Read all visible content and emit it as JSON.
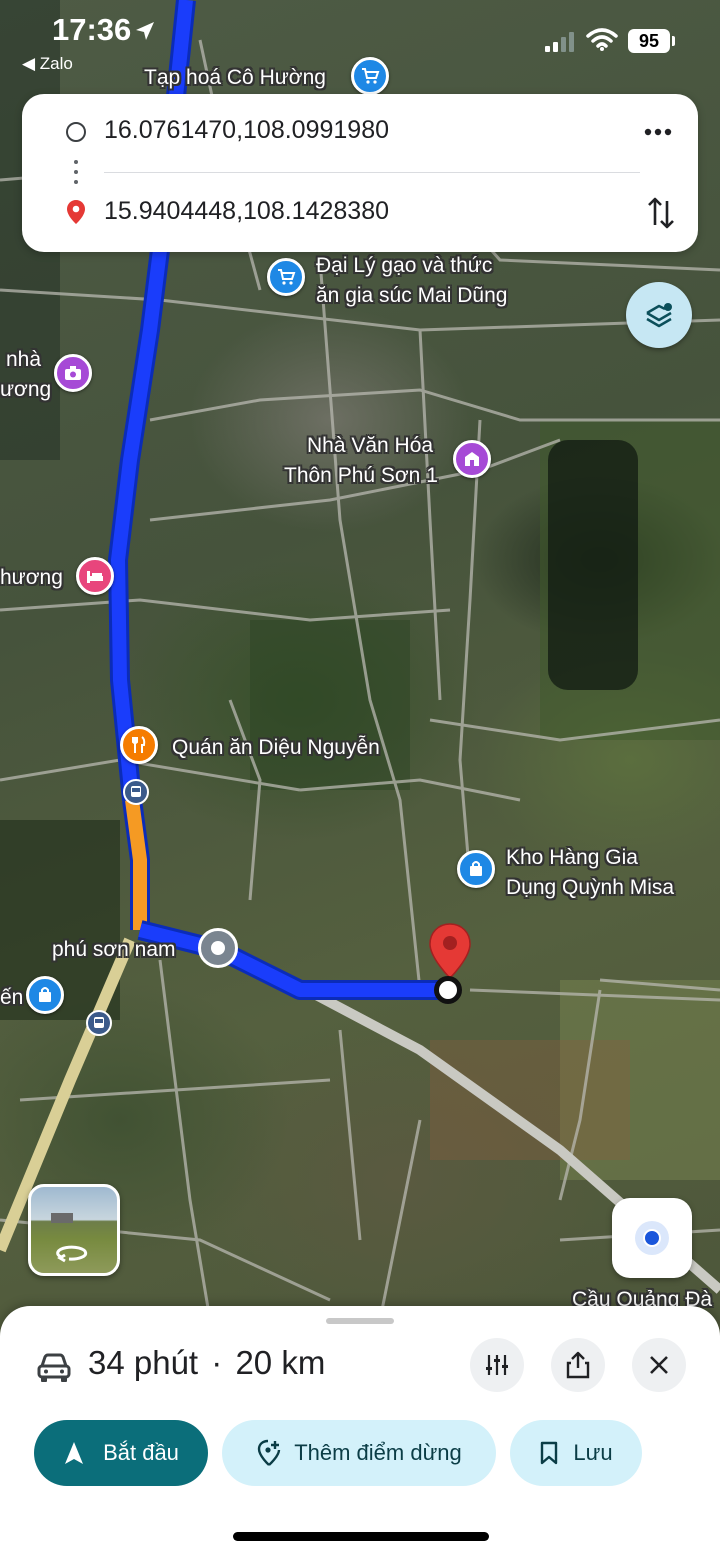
{
  "status_bar": {
    "time": "17:36",
    "back_app": "◀ Zalo",
    "battery": "95"
  },
  "directions": {
    "origin": "16.0761470,108.0991980",
    "destination": "15.9404448,108.1428380"
  },
  "map_labels": {
    "shop_co_huong": "Tạp hoá Cô Hường",
    "dai_ly_gao_1": "Đại Lý gạo và thức",
    "dai_ly_gao_2": "ăn gia súc Mai Dũng",
    "nha_1": "nhà",
    "nha_2": "ương",
    "van_hoa_1": "Nhà Văn Hóa",
    "van_hoa_2": "Thôn Phú Sơn 1",
    "huong": "hương",
    "quan_an": "Quán ăn Diệu Nguyễn",
    "kho_hang_1": "Kho Hàng Gia",
    "kho_hang_2": "Dụng Quỳnh Misa",
    "phu_son_nam": "phú sơn nam",
    "en": "ến",
    "cau_quang_da": "Cầu Quảng Đà"
  },
  "route": {
    "duration": "34 phút",
    "distance": "20 km",
    "separator": "·"
  },
  "actions": {
    "start": "Bắt đầu",
    "add_stop": "Thêm điểm dừng",
    "save": "Lưu"
  },
  "colors": {
    "route_blue": "#1a3dfb",
    "route_traffic": "#f59a23",
    "start_button": "#0b6e7a",
    "pill_bg": "#d3f1fa",
    "dest_pin": "#e53935"
  },
  "icons": [
    "location-arrow-icon",
    "signal-icon",
    "wifi-icon",
    "more-icon",
    "swap-icon",
    "layers-icon",
    "my-location-icon",
    "car-icon",
    "options-icon",
    "share-icon",
    "close-icon",
    "navigation-icon",
    "add-stop-icon",
    "bookmark-icon"
  ]
}
